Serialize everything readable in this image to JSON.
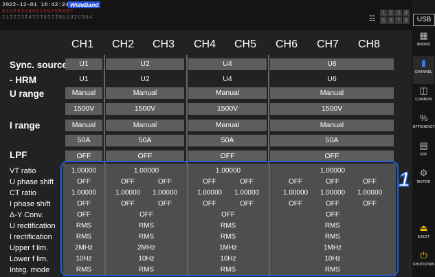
{
  "status": {
    "timestamp": "2022-12-01 10:42:24",
    "mode": "WideBand",
    "ind_row1": "U1U2U3U4U5U6U7U8ABC",
    "ind_row2": "I1I2I3I4I5I6I7I8U1U2U3U4",
    "grid": [
      "1",
      "2",
      "3",
      "4",
      "5",
      "6",
      "7",
      "8"
    ]
  },
  "usb": "USB",
  "sidebar": [
    {
      "label": "WIRING",
      "icon": "wiring-icon"
    },
    {
      "label": "CHANNEL",
      "icon": "channel-icon"
    },
    {
      "label": "COMMON",
      "icon": "common-icon"
    },
    {
      "label": "EFFICIENCY",
      "icon": "efficiency-icon"
    },
    {
      "label": "UDF",
      "icon": "udf-icon"
    },
    {
      "label": "MOTOR",
      "icon": "motor-icon"
    },
    {
      "label": "EJECT",
      "icon": "eject-icon"
    },
    {
      "label": "SHUTDOWN",
      "icon": "shutdown-icon"
    }
  ],
  "channels": [
    "CH1",
    "CH2",
    "CH3",
    "CH4",
    "CH5",
    "CH6",
    "CH7",
    "CH8"
  ],
  "rows": {
    "sync": "Sync. source",
    "hrm": "- HRM",
    "urange": "U range",
    "irange": "I range",
    "lpf": "LPF"
  },
  "sync_values": [
    "U1",
    "U2",
    "U4",
    "U6"
  ],
  "hrm_values": [
    "U1",
    "U2",
    "U4",
    "U6"
  ],
  "u_mode": [
    "Manual",
    "Manual",
    "Manual",
    "Manual"
  ],
  "u_val": [
    "1500V",
    "1500V",
    "1500V",
    "1500V"
  ],
  "i_mode": [
    "Manual",
    "Manual",
    "Manual",
    "Manual"
  ],
  "i_val": [
    "50A",
    "50A",
    "50A",
    "50A"
  ],
  "lpf": [
    "OFF",
    "OFF",
    "OFF",
    "OFF"
  ],
  "params": {
    "labels": [
      "VT ratio",
      "U phase shift",
      "CT ratio",
      "I phase shift",
      "Δ-Y Conv.",
      "U rectification",
      "I rectification",
      "Upper f lim.",
      "Lower f lim.",
      "Integ. mode"
    ],
    "vt": [
      "1.00000",
      "1.00000",
      "1.00000",
      "1.00000"
    ],
    "ups": [
      "OFF",
      "OFF",
      "OFF",
      "OFF",
      "OFF",
      "OFF",
      "OFF",
      "OFF"
    ],
    "ct": [
      "1.00000",
      "1.00000",
      "1.00000",
      "1.00000",
      "1.00000",
      "1.00000",
      "1.00000",
      "1.00000"
    ],
    "ips": [
      "OFF",
      "OFF",
      "OFF",
      "OFF",
      "OFF",
      "OFF",
      "OFF",
      "OFF"
    ],
    "dy": [
      "OFF",
      "OFF",
      "OFF",
      "OFF"
    ],
    "urect": [
      "RMS",
      "RMS",
      "RMS",
      "RMS"
    ],
    "irect": [
      "RMS",
      "RMS",
      "RMS",
      "RMS"
    ],
    "upf": [
      "2MHz",
      "2MHz",
      "1MHz",
      "1MHz"
    ],
    "lowf": [
      "10Hz",
      "10Hz",
      "10Hz",
      "10Hz"
    ],
    "integ": [
      "RMS",
      "RMS",
      "RMS",
      "RMS"
    ]
  },
  "callout": "1"
}
